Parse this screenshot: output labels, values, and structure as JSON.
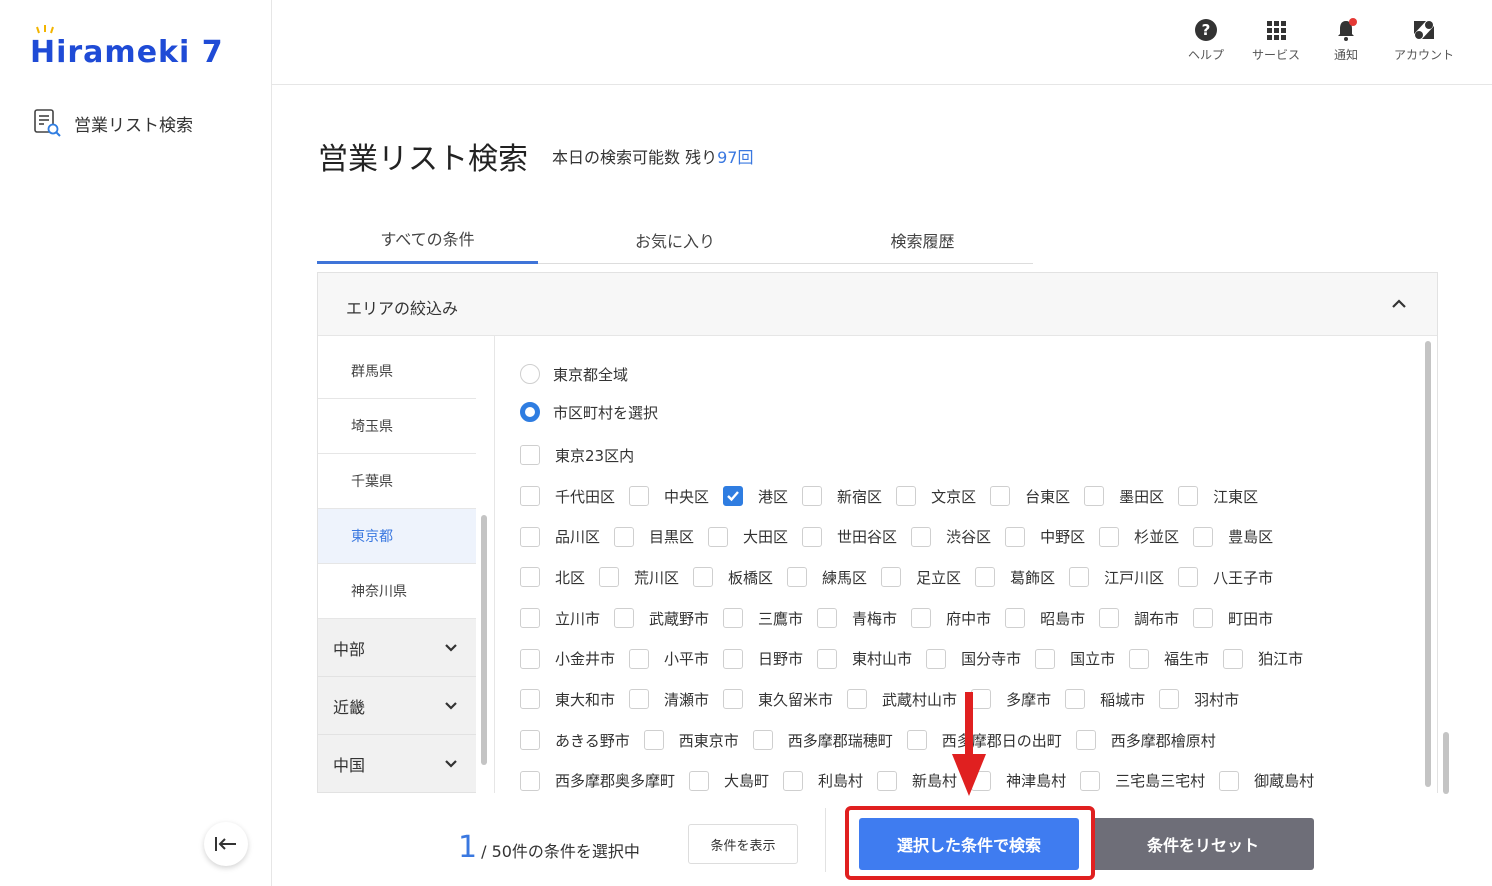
{
  "app": {
    "logo_text": "Hirameki 7"
  },
  "sidebar": {
    "nav_item": "営業リスト検索"
  },
  "header": {
    "items": [
      {
        "label": "ヘルプ",
        "icon": "help-icon"
      },
      {
        "label": "サービス",
        "icon": "grid-icon"
      },
      {
        "label": "通知",
        "icon": "bell-icon"
      },
      {
        "label": "アカウント",
        "icon": "account-icon"
      }
    ]
  },
  "page": {
    "title": "営業リスト検索",
    "remaining_prefix": "本日の検索可能数 残り",
    "remaining_count": "97回"
  },
  "tabs": [
    "すべての条件",
    "お気に入り",
    "検索履歴"
  ],
  "panel": {
    "title": "エリアの絞込み",
    "prefectures": [
      "群馬県",
      "埼玉県",
      "千葉県",
      "東京都",
      "神奈川県"
    ],
    "selected_prefecture": "東京都",
    "regions": [
      "中部",
      "近畿",
      "中国"
    ],
    "radio_all": "東京都全域",
    "radio_select": "市区町村を選択",
    "checkbox_23ku": "東京23区内",
    "municipalities": [
      [
        "千代田区",
        "中央区",
        "港区",
        "新宿区",
        "文京区",
        "台東区",
        "墨田区",
        "江東区"
      ],
      [
        "品川区",
        "目黒区",
        "大田区",
        "世田谷区",
        "渋谷区",
        "中野区",
        "杉並区",
        "豊島区"
      ],
      [
        "北区",
        "荒川区",
        "板橋区",
        "練馬区",
        "足立区",
        "葛飾区",
        "江戸川区",
        "八王子市"
      ],
      [
        "立川市",
        "武蔵野市",
        "三鷹市",
        "青梅市",
        "府中市",
        "昭島市",
        "調布市",
        "町田市"
      ],
      [
        "小金井市",
        "小平市",
        "日野市",
        "東村山市",
        "国分寺市",
        "国立市",
        "福生市",
        "狛江市"
      ],
      [
        "東大和市",
        "清瀬市",
        "東久留米市",
        "武蔵村山市",
        "多摩市",
        "稲城市",
        "羽村市"
      ],
      [
        "あきる野市",
        "西東京市",
        "西多摩郡瑞穂町",
        "西多摩郡日の出町",
        "西多摩郡檜原村"
      ],
      [
        "西多摩郡奥多摩町",
        "大島町",
        "利島村",
        "新島村",
        "神津島村",
        "三宅島三宅村",
        "御蔵島村"
      ]
    ],
    "checked": [
      "港区"
    ]
  },
  "footer": {
    "selected_count": "1",
    "selected_suffix": "/ 50件の条件を選択中",
    "show_conditions": "条件を表示",
    "search_button": "選択した条件で検索",
    "reset_button": "条件をリセット"
  },
  "colors": {
    "accent": "#3f7cf0",
    "highlight": "#e02020",
    "reset": "#6e6e78"
  }
}
